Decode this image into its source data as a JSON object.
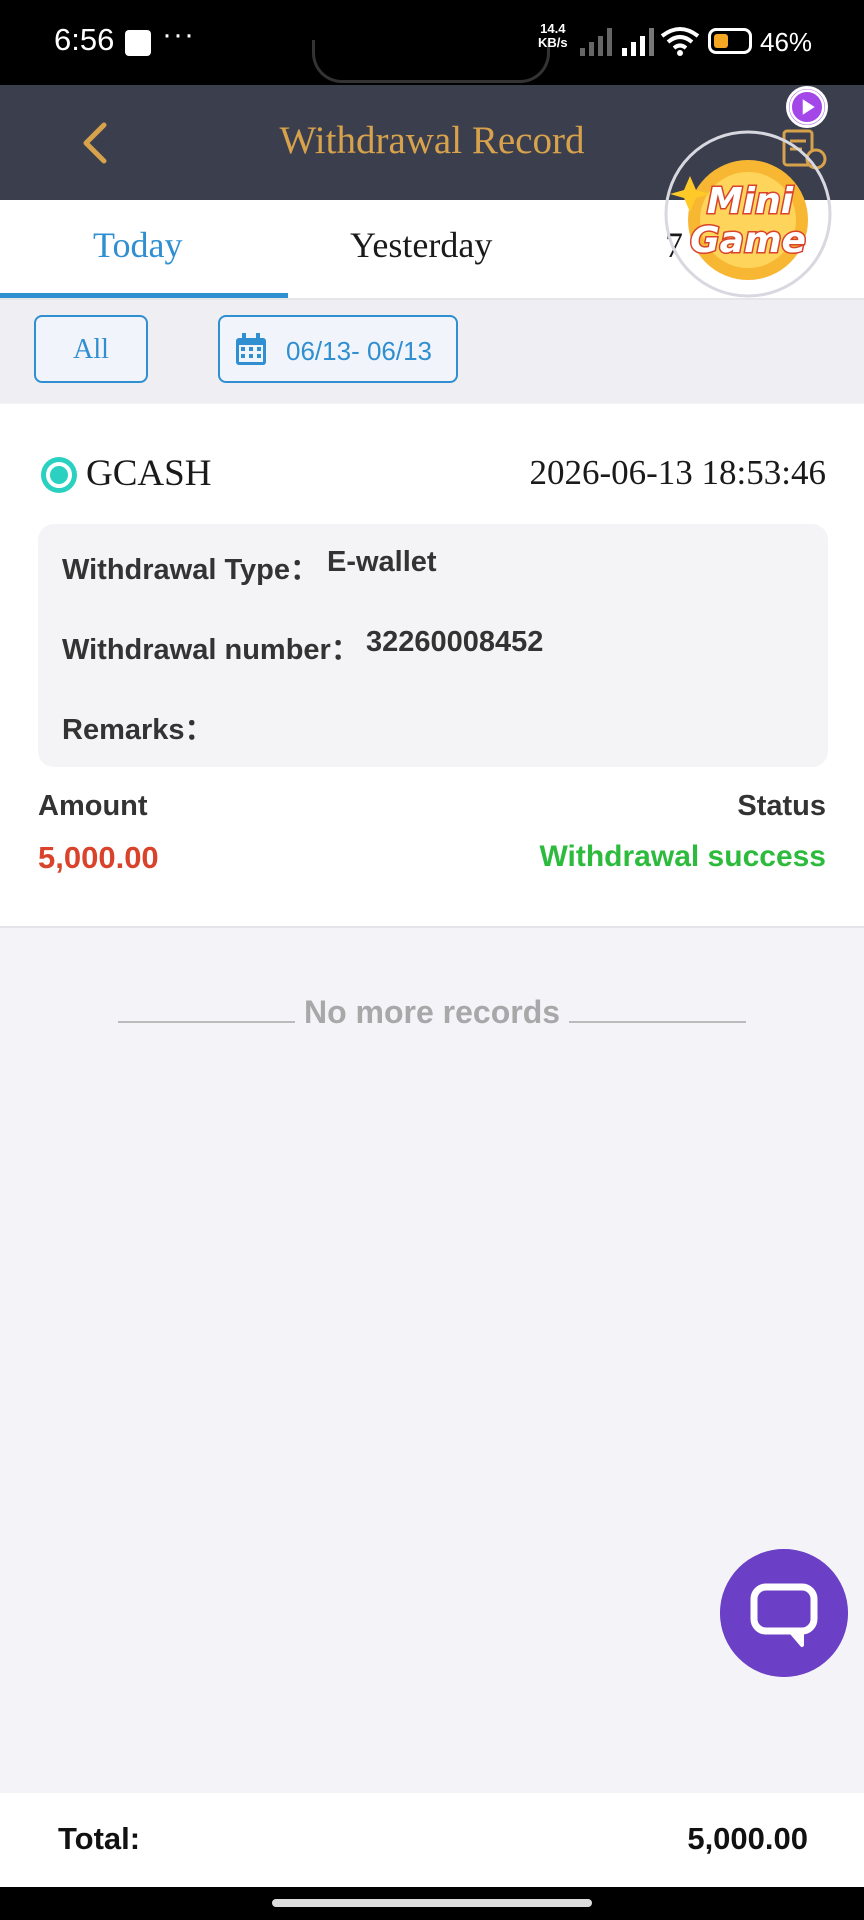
{
  "status_bar": {
    "time": "6:56",
    "more": "···",
    "net_speed_value": "14.4",
    "net_speed_unit": "KB/s",
    "battery_percent": "46%"
  },
  "header": {
    "title": "Withdrawal Record",
    "back_icon": "chevron-left-icon",
    "accent_color": "#d7a24b",
    "background_color": "#3b3f4d"
  },
  "tabs": [
    {
      "label": "Today",
      "active": true
    },
    {
      "label": "Yesterday",
      "active": false
    },
    {
      "label": "7",
      "active": false
    }
  ],
  "filters": {
    "type_label": "All",
    "date_range": "06/13- 06/13"
  },
  "record": {
    "method": "GCASH",
    "datetime": "2026-06-13 18:53:46",
    "type_label": "Withdrawal Type：",
    "type_value": "E-wallet",
    "number_label": "Withdrawal number：",
    "number_value": "32260008452",
    "remarks_label": "Remarks：",
    "remarks_value": "",
    "amount_label": "Amount",
    "amount_value": "5,000.00",
    "status_label": "Status",
    "status_value": "Withdrawal success",
    "amount_color": "#d9432c",
    "status_color": "#2dbb3d"
  },
  "list_end_text": "No more records",
  "mini_game": {
    "line1": "Mini",
    "line2": "Game"
  },
  "footer": {
    "total_label": "Total:",
    "total_value": "5,000.00"
  }
}
